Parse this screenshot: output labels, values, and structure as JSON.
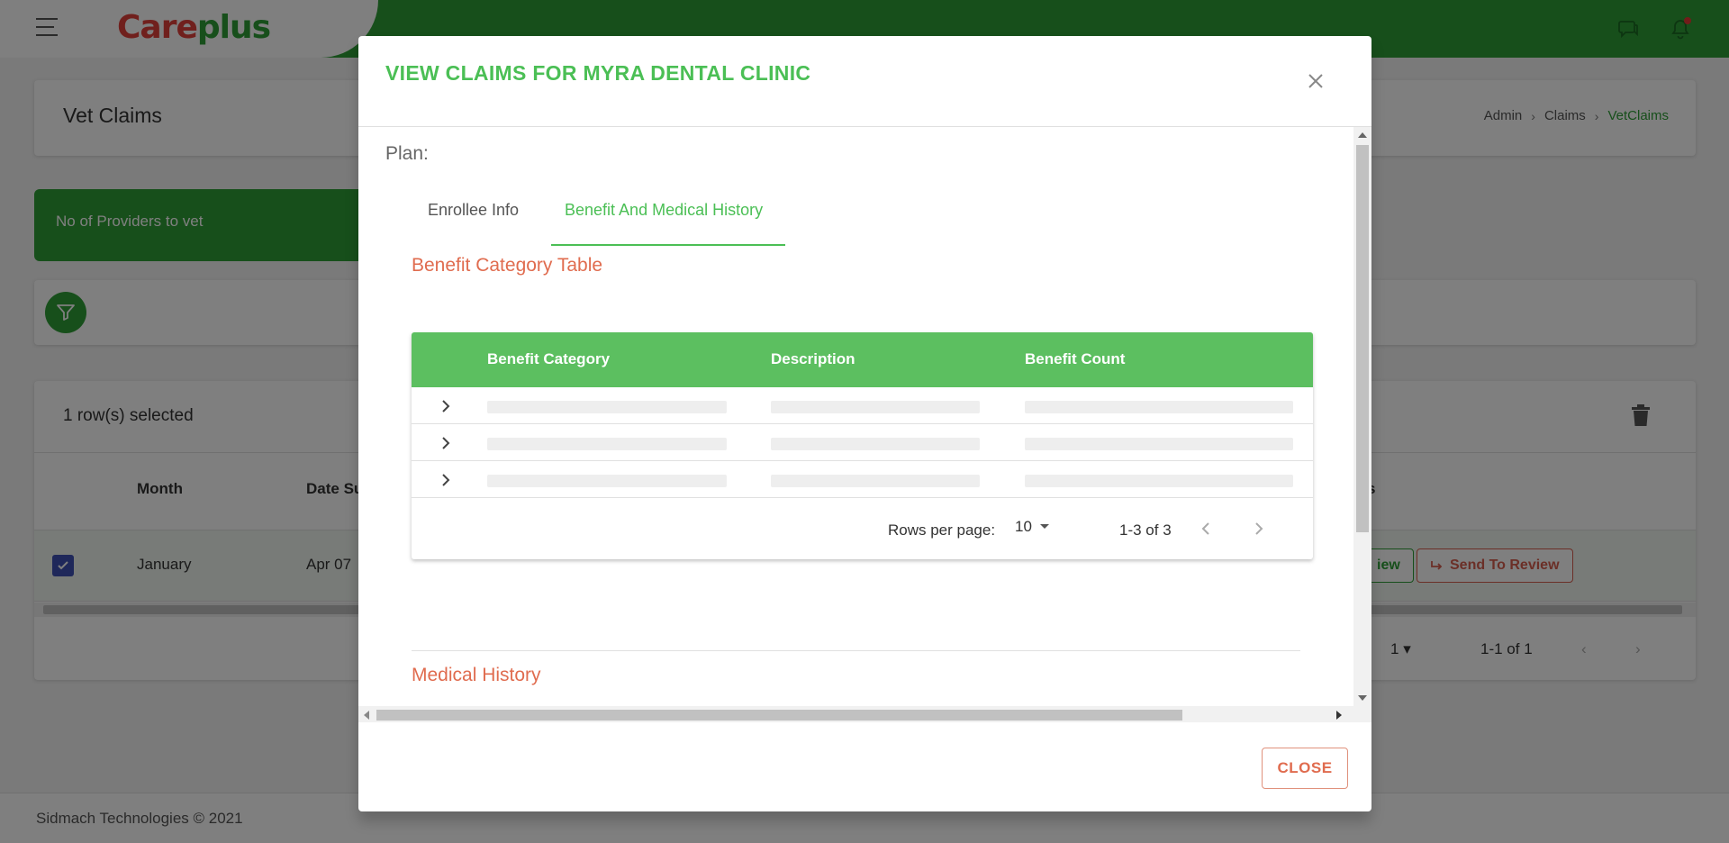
{
  "app": {
    "logo_left": "Care",
    "logo_right": "plus",
    "brand_color": "#2e9e36",
    "accent_color": "#4bbf55",
    "secondary_color": "#e06c4f"
  },
  "header": {
    "page_title": "Vet Claims",
    "breadcrumbs": [
      "Admin",
      "Claims",
      "VetClaims"
    ],
    "icons": [
      "menu-icon",
      "chat-icon",
      "bell-icon"
    ]
  },
  "providers_card": {
    "label": "No of Providers to vet"
  },
  "background_table": {
    "selected_text": "1 row(s) selected",
    "columns": [
      "Month",
      "Date Su"
    ],
    "partial_col": "s",
    "row": {
      "month": "January",
      "date": "Apr 07"
    },
    "view_label": "iew",
    "send_label": "Send To Review",
    "rows_value": "1",
    "range": "1-1 of 1"
  },
  "modal": {
    "title": "VIEW CLAIMS FOR MYRA DENTAL CLINIC",
    "plan_label": "Plan:",
    "tabs": [
      "Enrollee Info",
      "Benefit And Medical History"
    ],
    "active_tab": 1,
    "benefit_section_title": "Benefit Category Table",
    "benefit_columns": [
      "Benefit Category",
      "Description",
      "Benefit Count"
    ],
    "benefit_row_count": 3,
    "rows_per_page_label": "Rows per page:",
    "rows_per_page_value": "10",
    "range_text": "1-3 of 3",
    "medical_section_title": "Medical History",
    "close_label": "CLOSE"
  },
  "footer": {
    "text": "Sidmach Technologies © 2021"
  }
}
